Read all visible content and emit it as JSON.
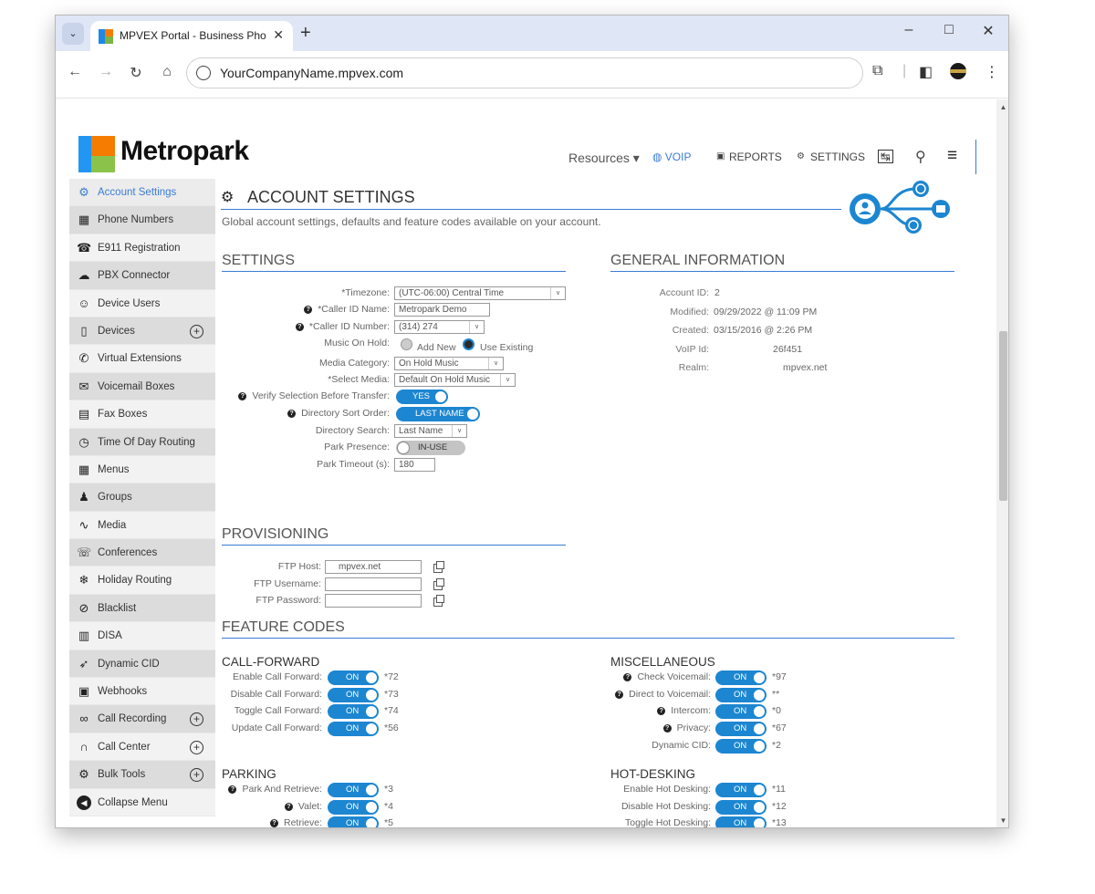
{
  "browser": {
    "tab_title": "MPVEX Portal - Business Phone",
    "url": "YourCompanyName.mpvex.com"
  },
  "header": {
    "logo_text": "Metropark",
    "nav": {
      "resources": "Resources ▾",
      "voip": "◍ VOIP",
      "reports": "REPORTS",
      "settings": "SETTINGS"
    }
  },
  "sidebar": {
    "items": [
      {
        "label": "Account Settings",
        "icon": "gears-icon"
      },
      {
        "label": "Phone Numbers",
        "icon": "grid-icon"
      },
      {
        "label": "E911 Registration",
        "icon": "phone-icon"
      },
      {
        "label": "PBX Connector",
        "icon": "cloud-icon"
      },
      {
        "label": "Device Users",
        "icon": "users-icon"
      },
      {
        "label": "Devices",
        "icon": "mobile-icon",
        "plus": true
      },
      {
        "label": "Virtual Extensions",
        "icon": "handset-icon"
      },
      {
        "label": "Voicemail Boxes",
        "icon": "inbox-icon"
      },
      {
        "label": "Fax Boxes",
        "icon": "fax-icon"
      },
      {
        "label": "Time Of Day Routing",
        "icon": "clock-icon"
      },
      {
        "label": "Menus",
        "icon": "menu-grid-icon"
      },
      {
        "label": "Groups",
        "icon": "group-icon"
      },
      {
        "label": "Media",
        "icon": "waveform-icon"
      },
      {
        "label": "Conferences",
        "icon": "conference-icon"
      },
      {
        "label": "Holiday Routing",
        "icon": "snowflake-icon"
      },
      {
        "label": "Blacklist",
        "icon": "blocked-user-icon"
      },
      {
        "label": "DISA",
        "icon": "disa-icon"
      },
      {
        "label": "Dynamic CID",
        "icon": "dynamic-icon"
      },
      {
        "label": "Webhooks",
        "icon": "webhook-icon"
      },
      {
        "label": "Call Recording",
        "icon": "recording-icon",
        "plus": true
      },
      {
        "label": "Call Center",
        "icon": "headset-icon",
        "plus": true
      },
      {
        "label": "Bulk Tools",
        "icon": "tools-icon",
        "plus": true
      },
      {
        "label": "Collapse Menu",
        "icon": "collapse-icon"
      }
    ]
  },
  "page": {
    "title": "ACCOUNT SETTINGS",
    "description": "Global account settings, defaults and feature codes available on your account."
  },
  "settings": {
    "title": "SETTINGS",
    "timezone_label": "*Timezone:",
    "timezone_value": "(UTC-06:00) Central Time",
    "caller_id_name_label": "*Caller ID Name:",
    "caller_id_name_value": "Metropark Demo",
    "caller_id_number_label": "*Caller ID Number:",
    "caller_id_number_value": "(314) 274",
    "music_on_hold_label": "Music On Hold:",
    "music_add_new": "Add New",
    "music_use_existing": "Use Existing",
    "media_category_label": "Media Category:",
    "media_category_value": "On Hold Music",
    "select_media_label": "*Select Media:",
    "select_media_value": "Default On Hold Music",
    "verify_label": "Verify Selection Before Transfer:",
    "verify_value": "YES",
    "sort_order_label": "Directory Sort Order:",
    "sort_order_value": "LAST NAME",
    "dir_search_label": "Directory Search:",
    "dir_search_value": "Last Name",
    "park_presence_label": "Park Presence:",
    "park_presence_value": "IN-USE",
    "park_timeout_label": "Park Timeout (s):",
    "park_timeout_value": "180"
  },
  "general_info": {
    "title": "GENERAL INFORMATION",
    "rows": [
      {
        "label": "Account ID:",
        "value": "2"
      },
      {
        "label": "Modified:",
        "value": "09/29/2022 @ 11:09 PM"
      },
      {
        "label": "Created:",
        "value": "03/15/2016 @ 2:26 PM"
      },
      {
        "label": "VoIP Id:",
        "value": "26f451"
      },
      {
        "label": "Realm:",
        "value": "mpvex.net"
      }
    ]
  },
  "provisioning": {
    "title": "PROVISIONING",
    "ftp_host_label": "FTP Host:",
    "ftp_host_value": "mpvex.net",
    "ftp_user_label": "FTP Username:",
    "ftp_user_value": "",
    "ftp_pass_label": "FTP Password:",
    "ftp_pass_value": ""
  },
  "feature_codes": {
    "title": "FEATURE CODES",
    "on_label": "ON",
    "call_forward": {
      "title": "CALL-FORWARD",
      "rows": [
        {
          "label": "Enable Call Forward:",
          "code": "*72"
        },
        {
          "label": "Disable Call Forward:",
          "code": "*73"
        },
        {
          "label": "Toggle Call Forward:",
          "code": "*74"
        },
        {
          "label": "Update Call Forward:",
          "code": "*56"
        }
      ]
    },
    "parking": {
      "title": "PARKING",
      "rows": [
        {
          "label": "Park And Retrieve:",
          "code": "*3"
        },
        {
          "label": "Valet:",
          "code": "*4"
        },
        {
          "label": "Retrieve:",
          "code": "*5"
        }
      ]
    },
    "misc": {
      "title": "MISCELLANEOUS",
      "rows": [
        {
          "label": "Check Voicemail:",
          "code": "*97"
        },
        {
          "label": "Direct to Voicemail:",
          "code": "**"
        },
        {
          "label": "Intercom:",
          "code": "*0"
        },
        {
          "label": "Privacy:",
          "code": "*67"
        },
        {
          "label": "Dynamic CID:",
          "code": "*2"
        }
      ]
    },
    "hot_desking": {
      "title": "HOT-DESKING",
      "rows": [
        {
          "label": "Enable Hot Desking:",
          "code": "*11"
        },
        {
          "label": "Disable Hot Desking:",
          "code": "*12"
        },
        {
          "label": "Toggle Hot Desking:",
          "code": "*13"
        }
      ]
    }
  },
  "colors": {
    "accent": "#3a7bd5",
    "toggle_on": "#1c86d1"
  }
}
